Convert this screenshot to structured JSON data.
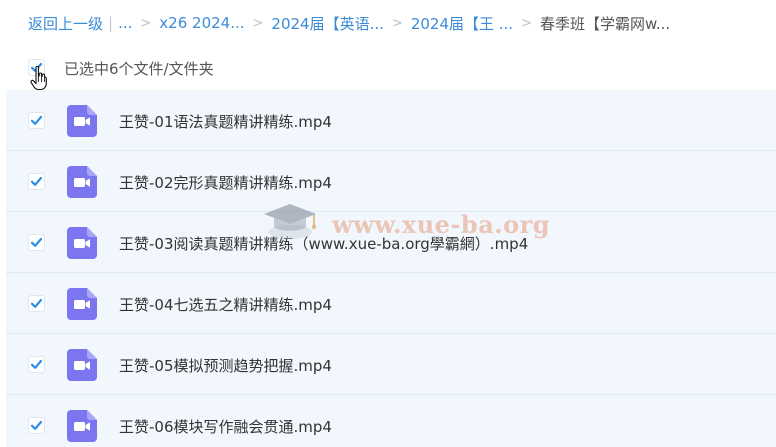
{
  "breadcrumb": {
    "back": "返回上一级",
    "ellipsis": "...",
    "items": [
      "x26 2024...",
      "2024届【英语...",
      "2024届【王 ...",
      "春季班【学霸网w..."
    ]
  },
  "selection": {
    "label": "已选中6个文件/文件夹"
  },
  "files": [
    {
      "name": "王赞-01语法真题精讲精练.mp4"
    },
    {
      "name": "王赞-02完形真题精讲精练.mp4"
    },
    {
      "name": "王赞-03阅读真题精讲精练（www.xue-ba.org學霸網）.mp4"
    },
    {
      "name": "王赞-04七选五之精讲精练.mp4"
    },
    {
      "name": "王赞-05模拟预测趋势把握.mp4"
    },
    {
      "name": "王赞-06模块写作融会贯通.mp4"
    }
  ],
  "watermark": {
    "text": "www.xue-ba.org"
  },
  "colors": {
    "link": "#3b8cd8",
    "checkbox_check": "#2b8ee6",
    "row_selected_bg": "#f1f7fd",
    "video_icon": "#7b76f0"
  }
}
